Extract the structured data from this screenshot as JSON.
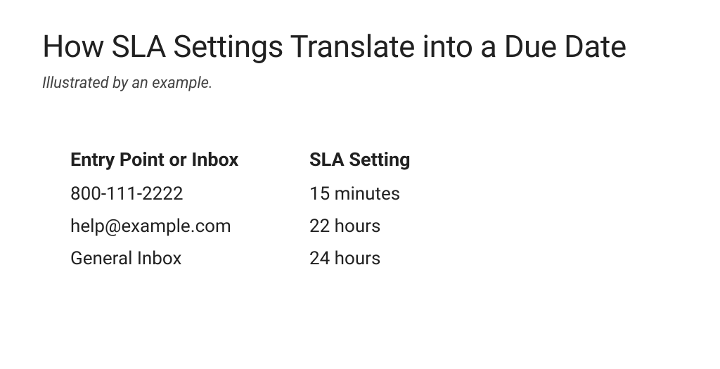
{
  "title": "How SLA Settings Translate into a Due Date",
  "subtitle": "Illustrated by an example.",
  "table": {
    "headers": {
      "entry": "Entry Point or Inbox",
      "sla": "SLA Setting"
    },
    "rows": [
      {
        "entry": "800-111-2222",
        "sla": "15 minutes"
      },
      {
        "entry": "help@example.com",
        "sla": "22 hours"
      },
      {
        "entry": "General Inbox",
        "sla": "24 hours"
      }
    ]
  }
}
